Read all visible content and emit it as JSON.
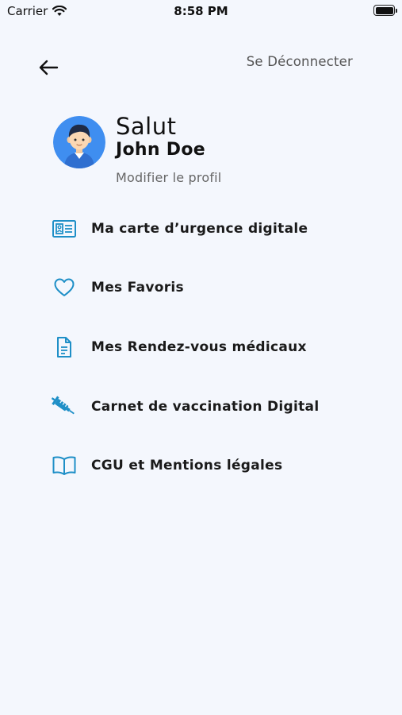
{
  "status_bar": {
    "carrier": "Carrier",
    "time": "8:58 PM"
  },
  "header": {
    "back_icon": "arrow-left-icon",
    "logout_label": "Se Déconnecter"
  },
  "profile": {
    "greeting": "Salut",
    "name": "John Doe",
    "edit_label": "Modifier le profil",
    "avatar_bg": "#3f8ef0"
  },
  "menu": {
    "items": [
      {
        "label": "Ma carte d’urgence digitale",
        "icon": "id-card-icon"
      },
      {
        "label": "Mes Favoris",
        "icon": "heart-icon"
      },
      {
        "label": "Mes Rendez-vous médicaux",
        "icon": "document-icon"
      },
      {
        "label": "Carnet de vaccination Digital",
        "icon": "syringe-icon"
      },
      {
        "label": "CGU et Mentions légales",
        "icon": "book-icon"
      }
    ]
  },
  "colors": {
    "background": "#f4f7fd",
    "icon_accent": "#1e8fc7",
    "text_primary": "#1a1a1a",
    "text_secondary": "#666666"
  }
}
